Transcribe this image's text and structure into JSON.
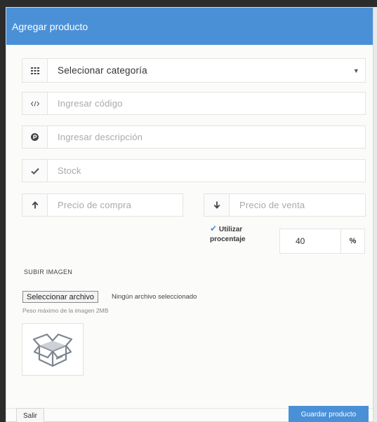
{
  "modal": {
    "title": "Agregar producto"
  },
  "form": {
    "category": {
      "icon": "grid-icon",
      "selected": "Selecionar categoría"
    },
    "code": {
      "icon": "code-icon",
      "placeholder": "Ingresar código"
    },
    "description": {
      "icon": "product-hunt-icon",
      "placeholder": "Ingresar descripción"
    },
    "stock": {
      "icon": "check-icon",
      "placeholder": "Stock"
    },
    "purchase_price": {
      "icon": "arrow-up-icon",
      "placeholder": "Precio de compra"
    },
    "sale_price": {
      "icon": "arrow-down-icon",
      "placeholder": "Precio de venta"
    },
    "percentage": {
      "label_line1": "Utilizar",
      "label_line2": "procentaje",
      "value": "40",
      "symbol": "%"
    }
  },
  "upload": {
    "title": "SUBIR IMAGEN",
    "button_label": "Seleccionar archivo",
    "no_file_text": "Ningún archivo seleccionado",
    "hint": "Peso máximo de la imagen 2MB",
    "preview_icon": "box-icon"
  },
  "footer": {
    "exit_label": "Salir",
    "save_label": "Guardar producto"
  },
  "colors": {
    "accent": "#4a90d6"
  }
}
